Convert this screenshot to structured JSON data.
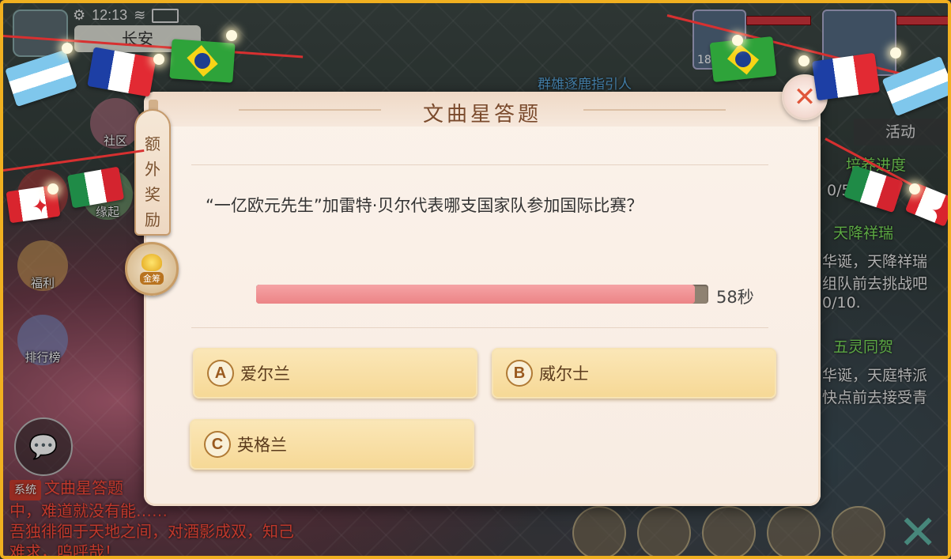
{
  "status": {
    "time": "12:13"
  },
  "location": "长安",
  "side_buttons": [
    {
      "label": "社区"
    },
    {
      "label": "活动"
    },
    {
      "label": "缘起"
    },
    {
      "label": "福利"
    },
    {
      "label": "排行榜"
    }
  ],
  "chat": {
    "tag": "系统",
    "lines": [
      "文曲星答题",
      "中，难道就没有能……",
      "吾独徘徊于天地之间，对酒影成双，知己",
      "难求，呜呼哉！"
    ]
  },
  "right_panel": {
    "tab": "活动",
    "lines": [
      "培养进度",
      "0/5",
      "天降祥瑞",
      "华诞，天降祥瑞",
      "组队前去挑战吧",
      "0/10.",
      "五灵同贺",
      "华诞，天庭特派",
      "快点前去接受青"
    ]
  },
  "player_level": "18",
  "npc_name": "群雄逐鹿指引人",
  "modal": {
    "title": "文曲星答题",
    "bonus_label": "额外奖励",
    "coin_label": "金筹",
    "question": "“一亿欧元先生”加雷特·贝尔代表哪支国家队参加国际比赛？",
    "timer": {
      "remaining_text": "58秒",
      "fraction_remaining": 0.97
    },
    "options": [
      {
        "letter": "A",
        "text": "爱尔兰"
      },
      {
        "letter": "B",
        "text": "威尔士"
      },
      {
        "letter": "C",
        "text": "英格兰"
      }
    ]
  },
  "icons": {
    "close": "close-icon",
    "coin": "gold-chip-icon",
    "chat": "chat-bubble-icon",
    "settings": "gear-icon"
  },
  "colors": {
    "frame": "#f0b020",
    "timer_fill": "#ec8486",
    "option_bg": "#f6d895",
    "close_x": "#e0563a"
  }
}
